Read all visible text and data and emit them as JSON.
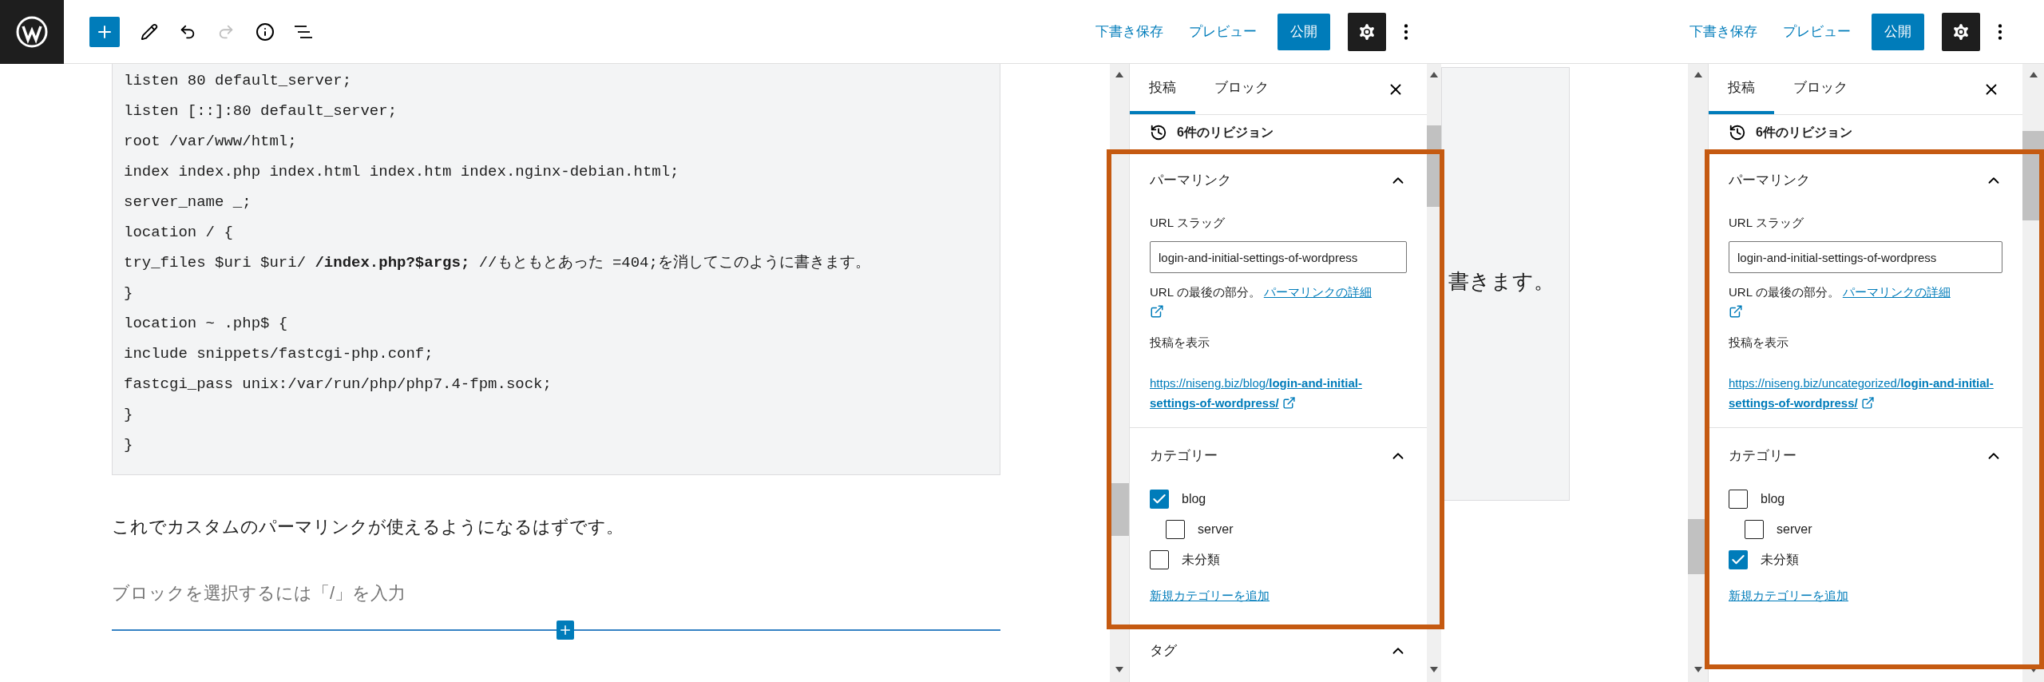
{
  "toolbar": {
    "redo_disabled": true
  },
  "editor": {
    "code_lines": [
      "listen 80 default_server;",
      "listen [::]:80 default_server;",
      "root /var/www/html;",
      "index index.php index.html index.htm index.nginx-debian.html;",
      "server_name _;",
      "location / {",
      "try_files $uri $uri/ **/index.php?$args;** //もともとあった =404;を消してこのように書きます。",
      "}",
      "location ~ .php$ {",
      "include snippets/fastcgi-php.conf;",
      "fastcgi_pass unix:/var/run/php/php7.4-fpm.sock;",
      "}",
      "}"
    ],
    "paragraph": "これでカスタムのパーマリンクが使えるようになるはずです。",
    "placeholder": "ブロックを選択するには「/」を入力"
  },
  "background_fragment": "書きます。",
  "screens": [
    {
      "header": {
        "save_draft": "下書き保存",
        "preview": "プレビュー",
        "publish": "公開",
        "settings_active": true
      },
      "sidebar": {
        "tabs": [
          {
            "label": "投稿",
            "selected": true
          },
          {
            "label": "ブロック",
            "selected": false
          }
        ],
        "revisions": "6件のリビジョン",
        "panels": [
          {
            "kind": "permalink",
            "title": "パーマリンク",
            "expanded": true,
            "slug_label": "URL スラッグ",
            "slug": "login-and-initial-settings-of-wordpress",
            "help": "URL の最後の部分。",
            "help_link": "パーマリンクの詳細",
            "view_label": "投稿を表示",
            "url": "https://niseng.biz/blog/**login-and-initial-settings-of-wordpress/**"
          },
          {
            "kind": "categories",
            "title": "カテゴリー",
            "expanded": true,
            "items": [
              {
                "label": "blog",
                "checked": true,
                "children": [
                  {
                    "label": "server",
                    "checked": false
                  }
                ]
              },
              {
                "label": "未分類",
                "checked": false
              }
            ],
            "add_link": "新規カテゴリーを追加"
          },
          {
            "kind": "tags",
            "title": "タグ",
            "expanded": true
          }
        ]
      }
    },
    {
      "header": {
        "save_draft": "下書き保存",
        "preview": "プレビュー",
        "publish": "公開",
        "settings_active": true
      },
      "sidebar": {
        "tabs": [
          {
            "label": "投稿",
            "selected": true
          },
          {
            "label": "ブロック",
            "selected": false
          }
        ],
        "revisions": "6件のリビジョン",
        "panels": [
          {
            "kind": "permalink",
            "title": "パーマリンク",
            "expanded": true,
            "slug_label": "URL スラッグ",
            "slug": "login-and-initial-settings-of-wordpress",
            "help": "URL の最後の部分。",
            "help_link": "パーマリンクの詳細",
            "view_label": "投稿を表示",
            "url": "https://niseng.biz/uncategorized/**login-and-initial-settings-of-wordpress/**"
          },
          {
            "kind": "categories",
            "title": "カテゴリー",
            "expanded": true,
            "items": [
              {
                "label": "blog",
                "checked": false,
                "children": [
                  {
                    "label": "server",
                    "checked": false
                  }
                ]
              },
              {
                "label": "未分類",
                "checked": true
              }
            ],
            "add_link": "新規カテゴリーを追加"
          }
        ]
      }
    }
  ]
}
